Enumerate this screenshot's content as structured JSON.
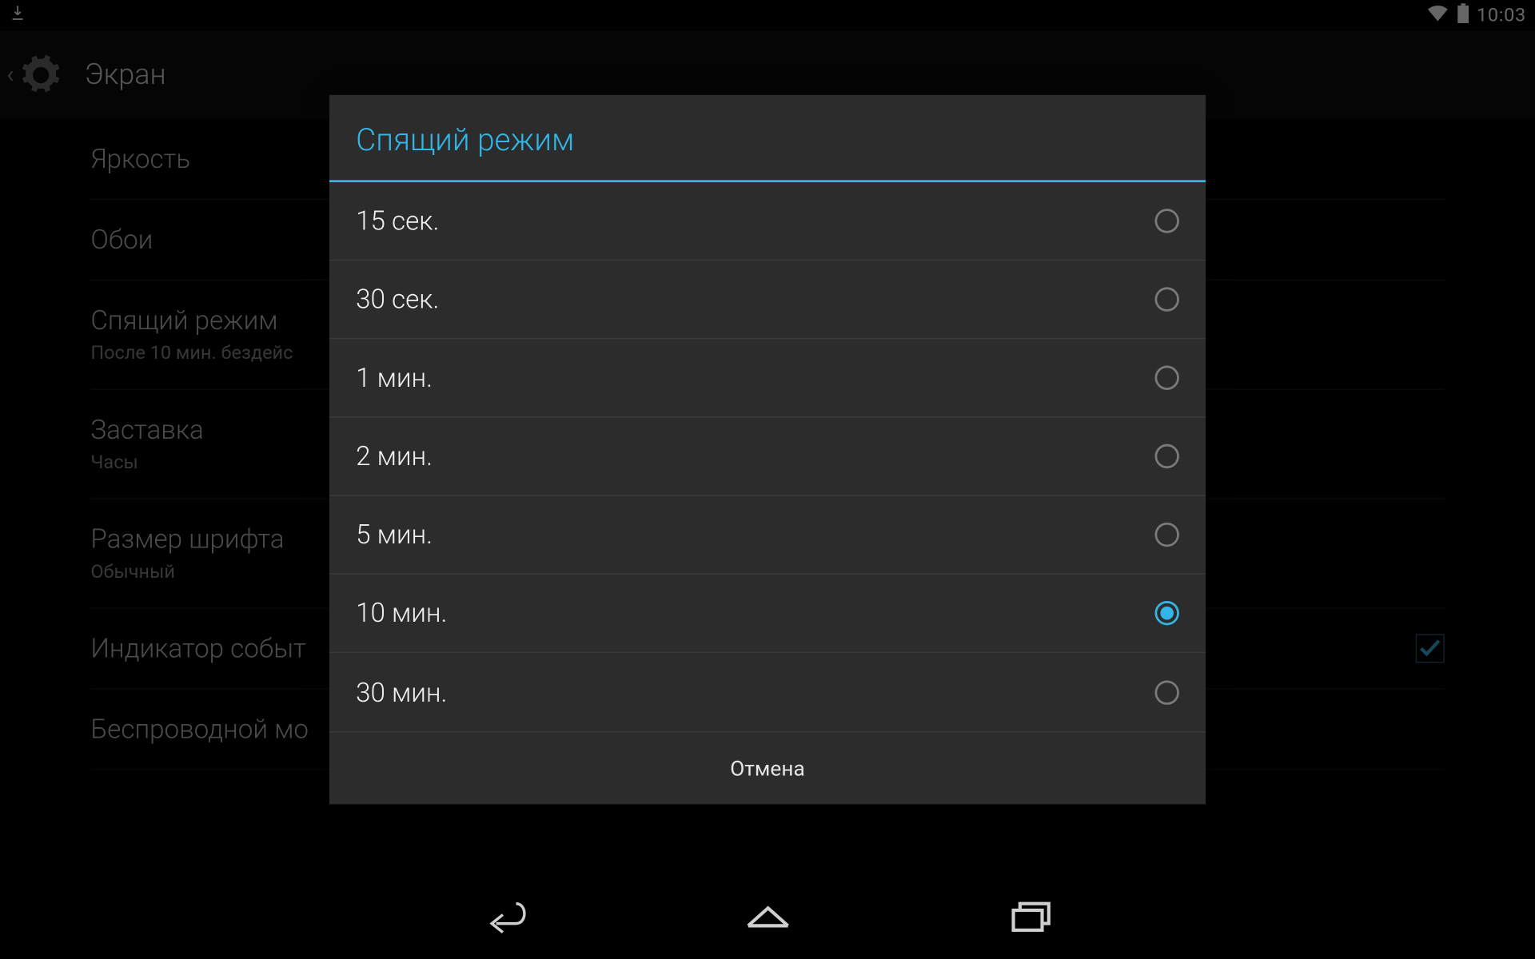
{
  "status": {
    "time": "10:03"
  },
  "actionBar": {
    "title": "Экран"
  },
  "settings": {
    "items": [
      {
        "primary": "Яркость",
        "secondary": ""
      },
      {
        "primary": "Обои",
        "secondary": ""
      },
      {
        "primary": "Спящий режим",
        "secondary": "После 10 мин. бездейс"
      },
      {
        "primary": "Заставка",
        "secondary": "Часы"
      },
      {
        "primary": "Размер шрифта",
        "secondary": "Обычный"
      },
      {
        "primary": "Индикатор событ",
        "secondary": "",
        "checked": true
      },
      {
        "primary": "Беспроводной мо",
        "secondary": ""
      }
    ]
  },
  "dialog": {
    "title": "Спящий режим",
    "options": [
      {
        "label": "15 сек.",
        "selected": false
      },
      {
        "label": "30 сек.",
        "selected": false
      },
      {
        "label": "1 мин.",
        "selected": false
      },
      {
        "label": "2 мин.",
        "selected": false
      },
      {
        "label": "5 мин.",
        "selected": false
      },
      {
        "label": "10 мин.",
        "selected": true
      },
      {
        "label": "30 мин.",
        "selected": false
      }
    ],
    "cancel": "Отмена"
  },
  "colors": {
    "accent": "#33b5e5",
    "dialogBg": "#2c2c2c"
  }
}
